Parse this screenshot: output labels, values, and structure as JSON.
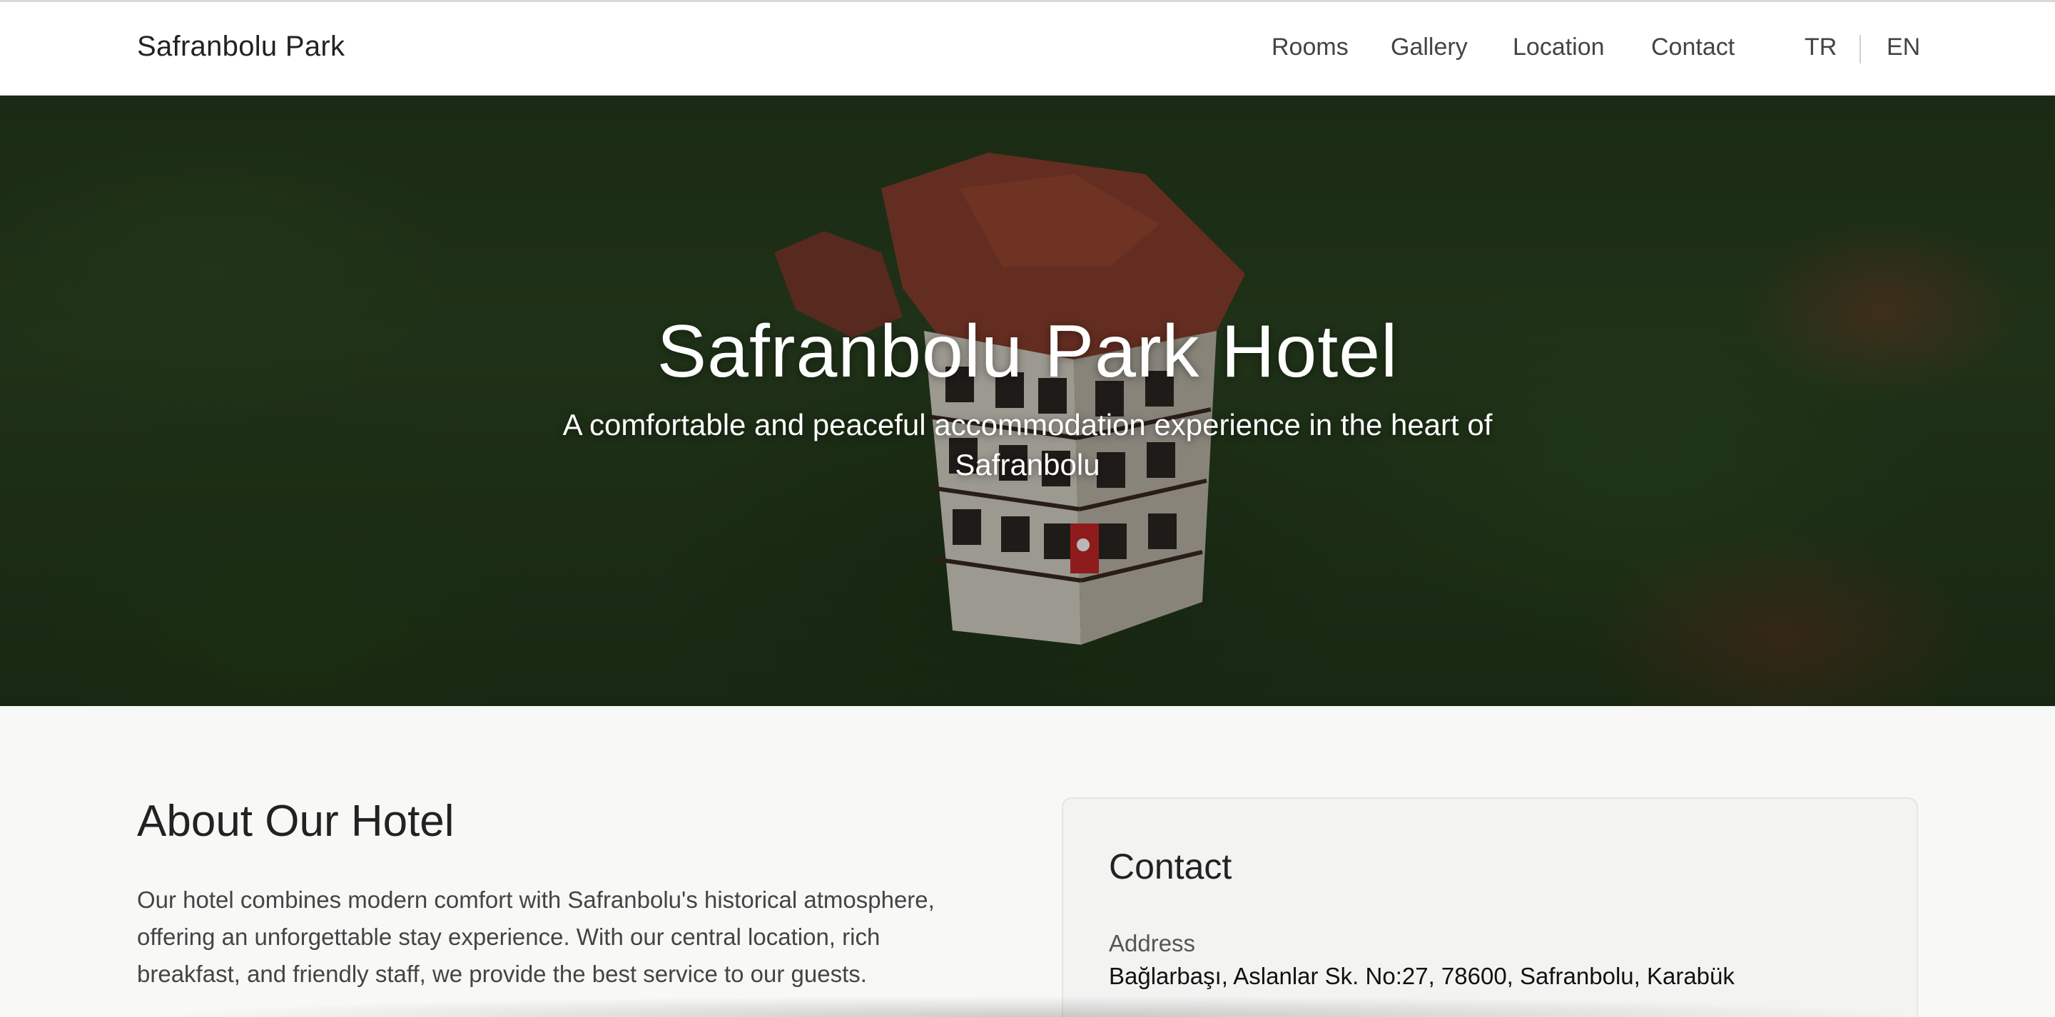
{
  "header": {
    "brand": "Safranbolu Park",
    "nav": {
      "rooms": "Rooms",
      "gallery": "Gallery",
      "location": "Location",
      "contact": "Contact"
    },
    "languages": {
      "tr": "TR",
      "en": "EN"
    }
  },
  "hero": {
    "title": "Safranbolu Park Hotel",
    "subtitle": "A comfortable and peaceful accommodation experience in the heart of Safranbolu"
  },
  "about": {
    "title": "About Our Hotel",
    "text": "Our hotel combines modern comfort with Safranbolu's historical atmosphere, offering an unforgettable stay experience. With our central location, rich breakfast, and friendly staff, we provide the best service to our guests."
  },
  "contact": {
    "title": "Contact",
    "address_label": "Address",
    "address_value": "Bağlarbaşı, Aslanlar Sk. No:27, 78600, Safranbolu, Karabük"
  },
  "colors": {
    "header_bg": "#ffffff",
    "page_bg": "#f8f8f6",
    "card_bg": "#f3f3f2",
    "text_primary": "#222222",
    "hero_text": "#ffffff"
  }
}
